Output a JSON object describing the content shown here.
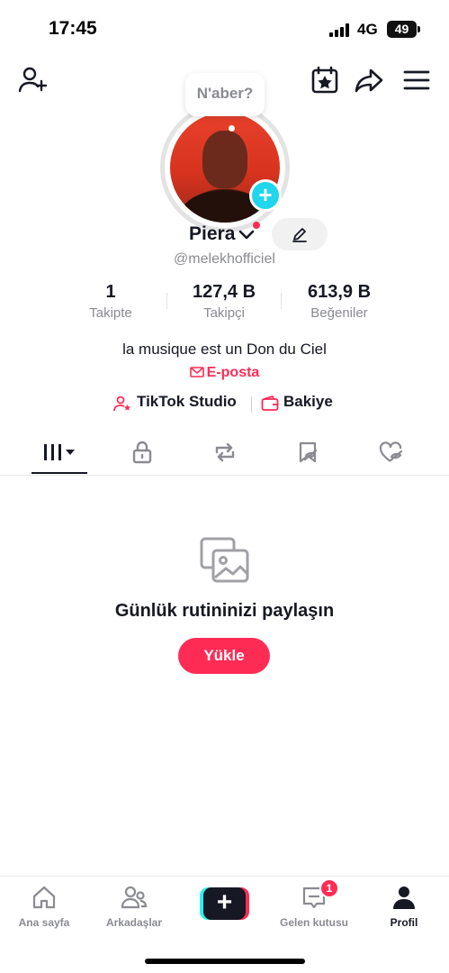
{
  "status_bar": {
    "time": "17:45",
    "network": "4G",
    "battery": "49"
  },
  "top_bar": {
    "add_friend_icon": "person-add-icon",
    "calendar_icon": "calendar-star-icon",
    "share_icon": "share-icon",
    "menu_icon": "hamburger-menu-icon"
  },
  "profile": {
    "note_bubble": "N'aber?",
    "name": "Piera",
    "handle": "@melekhofficiel",
    "bio": "la musique est un Don du Ciel",
    "email_label": "E-posta"
  },
  "stats": [
    {
      "value": "1",
      "label": "Takipte"
    },
    {
      "value": "127,4 B",
      "label": "Takipçi"
    },
    {
      "value": "613,9 B",
      "label": "Beğeniler"
    }
  ],
  "links": {
    "studio": "TikTok Studio",
    "balance": "Bakiye"
  },
  "tabs": [
    "videos-grid-icon",
    "lock-icon",
    "repost-icon",
    "favorites-icon",
    "liked-icon"
  ],
  "empty_state": {
    "title": "Günlük rutininizi paylaşın",
    "button": "Yükle"
  },
  "bottom_nav": {
    "home": "Ana sayfa",
    "friends": "Arkadaşlar",
    "inbox": "Gelen kutusu",
    "inbox_badge": "1",
    "profile": "Profil"
  },
  "colors": {
    "accent": "#fe2c55",
    "cyan": "#20d5ec",
    "text": "#161823",
    "muted": "#8a8b91"
  }
}
